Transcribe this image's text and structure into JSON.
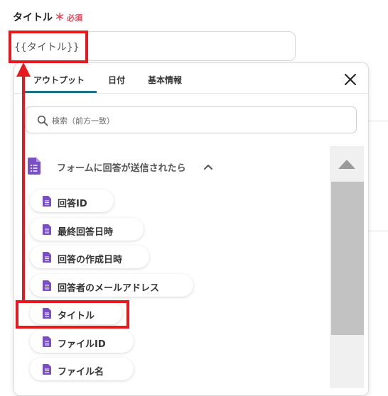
{
  "field": {
    "label": "タイトル",
    "required_star": "＊",
    "required_text": "必須",
    "value": "{{タイトル}}"
  },
  "tabs": [
    {
      "label": "アウトプット",
      "active": true
    },
    {
      "label": "日付",
      "active": false
    },
    {
      "label": "基本情報",
      "active": false
    }
  ],
  "search": {
    "placeholder": "検索（前方一致）"
  },
  "section": {
    "title": "フォームに回答が送信されたら"
  },
  "items": [
    {
      "label": "回答ID"
    },
    {
      "label": "最終回答日時"
    },
    {
      "label": "回答の作成日時"
    },
    {
      "label": "回答者のメールアドレス"
    },
    {
      "label": "タイトル",
      "highlighted": true
    },
    {
      "label": "ファイルID"
    },
    {
      "label": "ファイル名"
    }
  ],
  "colors": {
    "accent": "#1f6f87",
    "required": "#e5475a",
    "highlight": "#e5191f",
    "doc_icon": "#7b4fc4"
  },
  "icons": {
    "close": "close-icon",
    "search": "search-icon",
    "section": "google-forms-icon",
    "collapse": "chevron-up-icon",
    "item": "document-icon"
  }
}
